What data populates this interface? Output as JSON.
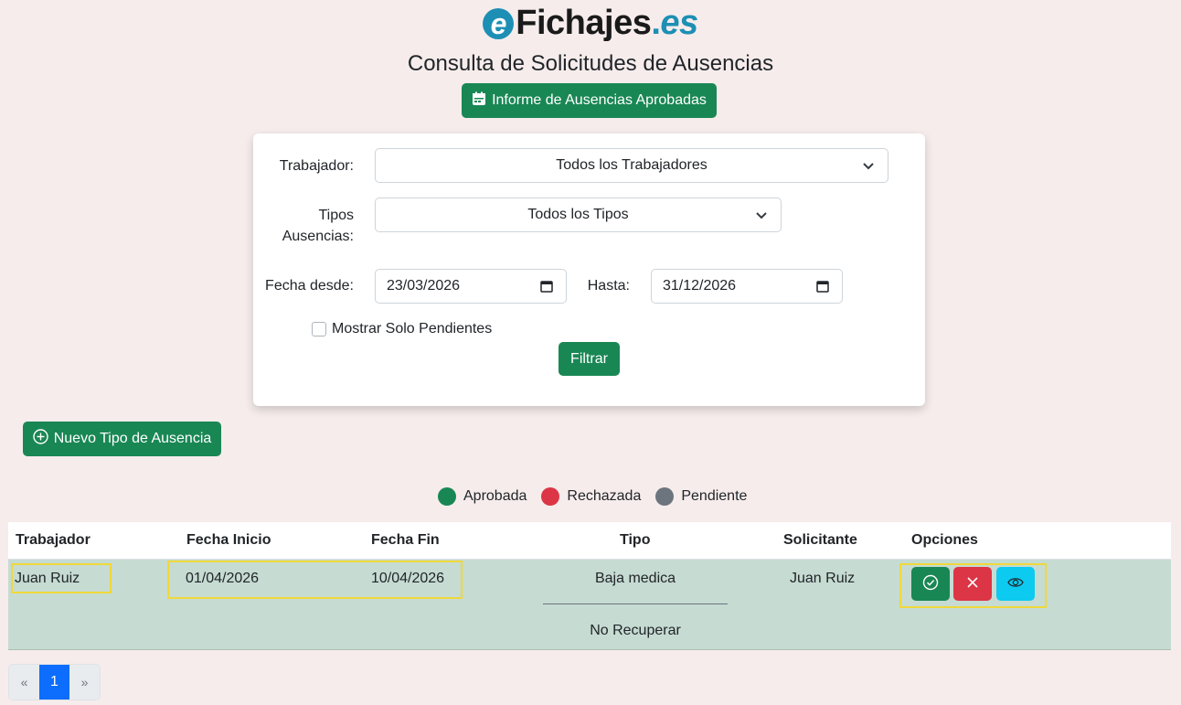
{
  "logo": {
    "e": "e",
    "main": "Fichajes",
    "dot": ".",
    "tld": "es"
  },
  "page_title": "Consulta de Solicitudes de Ausencias",
  "informe_button": "Informe de Ausencias Aprobadas",
  "filters": {
    "trabajador_label": "Trabajador:",
    "trabajador_value": "Todos los Trabajadores",
    "tipos_label_1": "Tipos",
    "tipos_label_2": "Ausencias:",
    "tipos_value": "Todos los Tipos",
    "fecha_desde_label": "Fecha desde:",
    "fecha_desde_value": "23/03/2026",
    "hasta_label": "Hasta:",
    "hasta_value": "31/12/2026",
    "pendientes_label": "Mostrar Solo Pendientes",
    "filtrar_button": "Filtrar"
  },
  "nuevo_tipo_button": "Nuevo Tipo de Ausencia",
  "legend": [
    {
      "label": "Aprobada",
      "color": "#198754"
    },
    {
      "label": "Rechazada",
      "color": "#dc3545"
    },
    {
      "label": "Pendiente",
      "color": "#6c757d"
    }
  ],
  "table": {
    "headers": [
      "Trabajador",
      "Fecha Inicio",
      "Fecha Fin",
      "Tipo",
      "Solicitante",
      "Opciones"
    ],
    "rows": [
      {
        "trabajador": "Juan Ruiz",
        "fecha_inicio": "01/04/2026",
        "fecha_fin": "10/04/2026",
        "tipo": "Baja medica",
        "tipo_detalle": "No Recuperar",
        "solicitante": "Juan Ruiz"
      }
    ]
  },
  "actions": {
    "approve_icon": "check-circle-icon",
    "reject_icon": "x-icon",
    "view_icon": "eye-icon"
  },
  "pagination": {
    "prev": "«",
    "current": "1",
    "next": "»"
  },
  "colors": {
    "primary_green": "#198754",
    "danger_red": "#dc3545",
    "info_cyan": "#0dcaf0",
    "page_blue": "#0d6efd",
    "row_background": "#c6dbd2",
    "highlight": "#f0d83a"
  }
}
